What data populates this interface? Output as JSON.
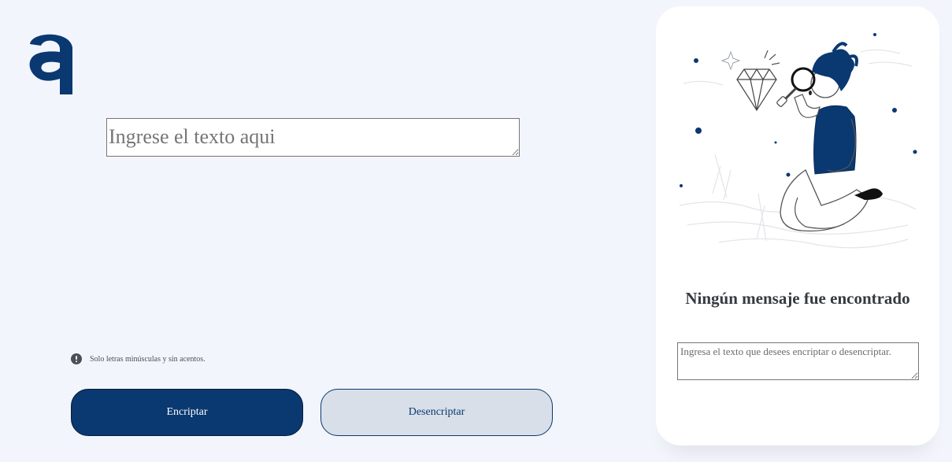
{
  "brand": {
    "logo_icon": "alura-a-logo-icon",
    "accent_color": "#0a3871"
  },
  "input": {
    "placeholder": "Ingrese el texto aqui",
    "value": ""
  },
  "hint": {
    "icon": "exclamation-circle-icon",
    "text": "Solo letras minúsculas y sin acentos."
  },
  "buttons": {
    "encrypt_label": "Encriptar",
    "decrypt_label": "Desencriptar",
    "encrypt_color": "#0a3871",
    "decrypt_color": "#d8dfe8"
  },
  "output_panel": {
    "illustration": "boy-with-magnifying-glass-illustration",
    "title": "Ningún mensaje fue encontrado",
    "placeholder": "Ingresa el texto que desees encriptar o desencriptar.",
    "value": ""
  }
}
